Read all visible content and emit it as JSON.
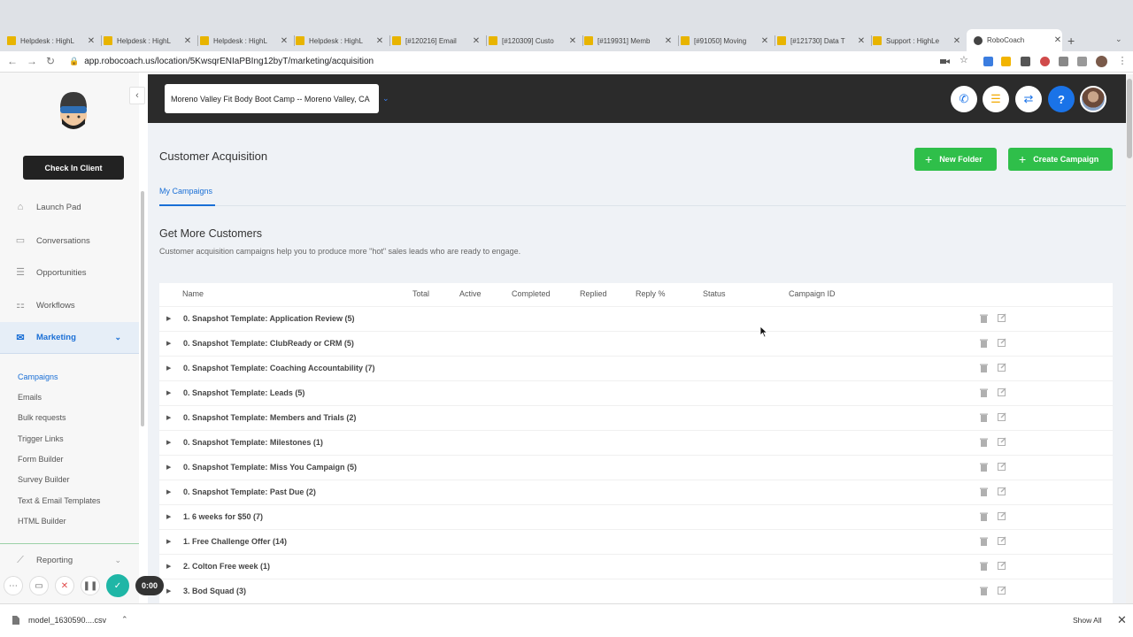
{
  "browser": {
    "tabs": [
      {
        "title": "Helpdesk : HighL"
      },
      {
        "title": "Helpdesk : HighL"
      },
      {
        "title": "Helpdesk : HighL"
      },
      {
        "title": "Helpdesk : HighL"
      },
      {
        "title": "[#120216] Email"
      },
      {
        "title": "[#120309] Custo"
      },
      {
        "title": "[#119931] Memb"
      },
      {
        "title": "[#91050] Moving"
      },
      {
        "title": "[#121730] Data T"
      },
      {
        "title": "Support : HighLe"
      },
      {
        "title": "RoboCoach",
        "active": true
      }
    ],
    "new_tab": "+",
    "url": "app.robocoach.us/location/5KwsqrENIaPBIng12byT/marketing/acquisition"
  },
  "sidebar": {
    "collapse": "‹",
    "check_in_label": "Check In Client",
    "nav": [
      {
        "label": "Launch Pad",
        "icon": "rocket-icon"
      },
      {
        "label": "Conversations",
        "icon": "chat-icon"
      },
      {
        "label": "Opportunities",
        "icon": "layers-icon"
      },
      {
        "label": "Workflows",
        "icon": "sitemap-icon"
      },
      {
        "label": "Marketing",
        "icon": "mail-icon",
        "active": true
      }
    ],
    "marketing_sub": [
      "Campaigns",
      "Emails",
      "Bulk requests",
      "Trigger Links",
      "Form Builder",
      "Survey Builder",
      "Text & Email Templates",
      "HTML Builder"
    ],
    "reporting_label": "Reporting"
  },
  "recorder": {
    "time": "0:00"
  },
  "header": {
    "location": "Moreno Valley Fit Body Boot Camp -- Moreno Valley, CA",
    "help": "?"
  },
  "page": {
    "title": "Customer Acquisition",
    "new_folder": "New Folder",
    "create_campaign": "Create Campaign",
    "tab": "My Campaigns",
    "section_title": "Get More Customers",
    "section_sub": "Customer acquisition campaigns help you to produce more \"hot\" sales leads who are ready to engage."
  },
  "table": {
    "columns": [
      "Name",
      "Total",
      "Active",
      "Completed",
      "Replied",
      "Reply %",
      "Status",
      "Campaign ID"
    ],
    "rows": [
      "0. Snapshot Template: Application Review (5)",
      "0. Snapshot Template: ClubReady or CRM (5)",
      "0. Snapshot Template: Coaching Accountability  (7)",
      "0. Snapshot Template: Leads (5)",
      "0. Snapshot Template: Members and Trials (2)",
      "0. Snapshot Template: Milestones (1)",
      "0. Snapshot Template: Miss You Campaign (5)",
      "0. Snapshot Template: Past Due (2)",
      "1. 6 weeks for $50 (7)",
      "1. Free Challenge Offer  (14)",
      "2. Colton Free week (1)",
      "3. Bod Squad (3)"
    ]
  },
  "downloads": {
    "file": "model_1630590....csv",
    "show_all": "Show All"
  },
  "colors": {
    "accent": "#1a6fd6",
    "green": "#2fbf4a",
    "topbar": "#2b2b2b"
  }
}
